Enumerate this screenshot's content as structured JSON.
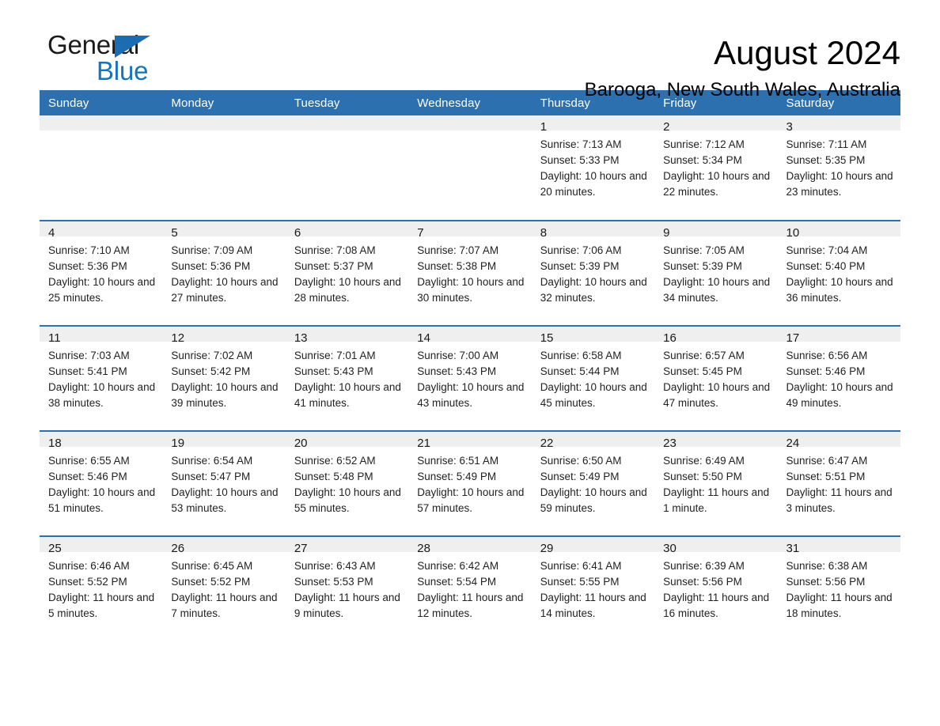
{
  "branding": {
    "logo_word_1": "General",
    "logo_word_2": "Blue",
    "logo_triangle_color": "#1b6cb0",
    "logo_blue_text_color": "#1574bd"
  },
  "header": {
    "month_title": "August 2024",
    "location": "Barooga, New South Wales, Australia"
  },
  "colors": {
    "header_blue": "#2c70b0",
    "daynum_band": "#efefef",
    "row_divider": "#2c70b0",
    "page_background": "#ffffff",
    "body_text": "#222222"
  },
  "weekday_headers": [
    "Sunday",
    "Monday",
    "Tuesday",
    "Wednesday",
    "Thursday",
    "Friday",
    "Saturday"
  ],
  "weeks": [
    [
      {
        "day": "",
        "text": ""
      },
      {
        "day": "",
        "text": ""
      },
      {
        "day": "",
        "text": ""
      },
      {
        "day": "",
        "text": ""
      },
      {
        "day": "1",
        "text": "Sunrise: 7:13 AM\nSunset: 5:33 PM\nDaylight: 10 hours and 20 minutes."
      },
      {
        "day": "2",
        "text": "Sunrise: 7:12 AM\nSunset: 5:34 PM\nDaylight: 10 hours and 22 minutes."
      },
      {
        "day": "3",
        "text": "Sunrise: 7:11 AM\nSunset: 5:35 PM\nDaylight: 10 hours and 23 minutes."
      }
    ],
    [
      {
        "day": "4",
        "text": "Sunrise: 7:10 AM\nSunset: 5:36 PM\nDaylight: 10 hours and 25 minutes."
      },
      {
        "day": "5",
        "text": "Sunrise: 7:09 AM\nSunset: 5:36 PM\nDaylight: 10 hours and 27 minutes."
      },
      {
        "day": "6",
        "text": "Sunrise: 7:08 AM\nSunset: 5:37 PM\nDaylight: 10 hours and 28 minutes."
      },
      {
        "day": "7",
        "text": "Sunrise: 7:07 AM\nSunset: 5:38 PM\nDaylight: 10 hours and 30 minutes."
      },
      {
        "day": "8",
        "text": "Sunrise: 7:06 AM\nSunset: 5:39 PM\nDaylight: 10 hours and 32 minutes."
      },
      {
        "day": "9",
        "text": "Sunrise: 7:05 AM\nSunset: 5:39 PM\nDaylight: 10 hours and 34 minutes."
      },
      {
        "day": "10",
        "text": "Sunrise: 7:04 AM\nSunset: 5:40 PM\nDaylight: 10 hours and 36 minutes."
      }
    ],
    [
      {
        "day": "11",
        "text": "Sunrise: 7:03 AM\nSunset: 5:41 PM\nDaylight: 10 hours and 38 minutes."
      },
      {
        "day": "12",
        "text": "Sunrise: 7:02 AM\nSunset: 5:42 PM\nDaylight: 10 hours and 39 minutes."
      },
      {
        "day": "13",
        "text": "Sunrise: 7:01 AM\nSunset: 5:43 PM\nDaylight: 10 hours and 41 minutes."
      },
      {
        "day": "14",
        "text": "Sunrise: 7:00 AM\nSunset: 5:43 PM\nDaylight: 10 hours and 43 minutes."
      },
      {
        "day": "15",
        "text": "Sunrise: 6:58 AM\nSunset: 5:44 PM\nDaylight: 10 hours and 45 minutes."
      },
      {
        "day": "16",
        "text": "Sunrise: 6:57 AM\nSunset: 5:45 PM\nDaylight: 10 hours and 47 minutes."
      },
      {
        "day": "17",
        "text": "Sunrise: 6:56 AM\nSunset: 5:46 PM\nDaylight: 10 hours and 49 minutes."
      }
    ],
    [
      {
        "day": "18",
        "text": "Sunrise: 6:55 AM\nSunset: 5:46 PM\nDaylight: 10 hours and 51 minutes."
      },
      {
        "day": "19",
        "text": "Sunrise: 6:54 AM\nSunset: 5:47 PM\nDaylight: 10 hours and 53 minutes."
      },
      {
        "day": "20",
        "text": "Sunrise: 6:52 AM\nSunset: 5:48 PM\nDaylight: 10 hours and 55 minutes."
      },
      {
        "day": "21",
        "text": "Sunrise: 6:51 AM\nSunset: 5:49 PM\nDaylight: 10 hours and 57 minutes."
      },
      {
        "day": "22",
        "text": "Sunrise: 6:50 AM\nSunset: 5:49 PM\nDaylight: 10 hours and 59 minutes."
      },
      {
        "day": "23",
        "text": "Sunrise: 6:49 AM\nSunset: 5:50 PM\nDaylight: 11 hours and 1 minute."
      },
      {
        "day": "24",
        "text": "Sunrise: 6:47 AM\nSunset: 5:51 PM\nDaylight: 11 hours and 3 minutes."
      }
    ],
    [
      {
        "day": "25",
        "text": "Sunrise: 6:46 AM\nSunset: 5:52 PM\nDaylight: 11 hours and 5 minutes."
      },
      {
        "day": "26",
        "text": "Sunrise: 6:45 AM\nSunset: 5:52 PM\nDaylight: 11 hours and 7 minutes."
      },
      {
        "day": "27",
        "text": "Sunrise: 6:43 AM\nSunset: 5:53 PM\nDaylight: 11 hours and 9 minutes."
      },
      {
        "day": "28",
        "text": "Sunrise: 6:42 AM\nSunset: 5:54 PM\nDaylight: 11 hours and 12 minutes."
      },
      {
        "day": "29",
        "text": "Sunrise: 6:41 AM\nSunset: 5:55 PM\nDaylight: 11 hours and 14 minutes."
      },
      {
        "day": "30",
        "text": "Sunrise: 6:39 AM\nSunset: 5:56 PM\nDaylight: 11 hours and 16 minutes."
      },
      {
        "day": "31",
        "text": "Sunrise: 6:38 AM\nSunset: 5:56 PM\nDaylight: 11 hours and 18 minutes."
      }
    ]
  ]
}
